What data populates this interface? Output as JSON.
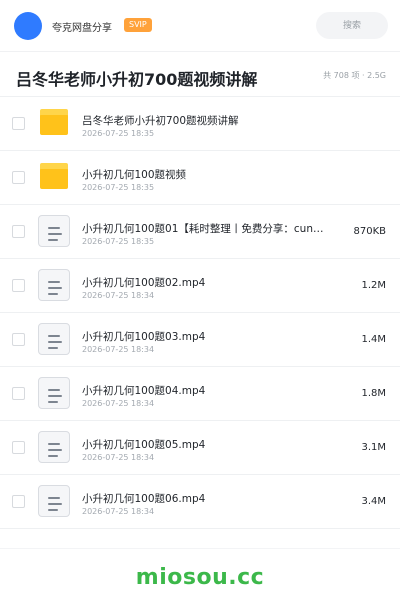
{
  "header": {
    "username": "夸克网盘分享",
    "badge": "SVIP",
    "search_label": "搜索"
  },
  "folder": {
    "title": "吕冬华老师小升初700题视频讲解",
    "meta": "共 708 项 · 2.5G"
  },
  "files": [
    {
      "type": "folder",
      "name": "吕冬华老师小升初700题视频讲解",
      "date": "2026-07-25 18:35",
      "size": ""
    },
    {
      "type": "folder",
      "name": "小升初几何100题视频",
      "date": "2026-07-25 18:35",
      "size": ""
    },
    {
      "type": "file",
      "name": "小升初几何100题01【耗时整理丨免费分享：cun…",
      "date": "2026-07-25 18:35",
      "size": "870KB"
    },
    {
      "type": "file",
      "name": "小升初几何100题02.mp4",
      "date": "2026-07-25 18:34",
      "size": "1.2M"
    },
    {
      "type": "file",
      "name": "小升初几何100题03.mp4",
      "date": "2026-07-25 18:34",
      "size": "1.4M"
    },
    {
      "type": "file",
      "name": "小升初几何100题04.mp4",
      "date": "2026-07-25 18:34",
      "size": "1.8M"
    },
    {
      "type": "file",
      "name": "小升初几何100题05.mp4",
      "date": "2026-07-25 18:34",
      "size": "3.1M"
    },
    {
      "type": "file",
      "name": "小升初几何100题06.mp4",
      "date": "2026-07-25 18:34",
      "size": "3.4M"
    }
  ],
  "watermark": "miosou.cc",
  "colors": {
    "avatar": "#2f7bff",
    "badge": "#ffa23a",
    "folder": "#ffc21a",
    "watermark": "#3cb84a"
  }
}
